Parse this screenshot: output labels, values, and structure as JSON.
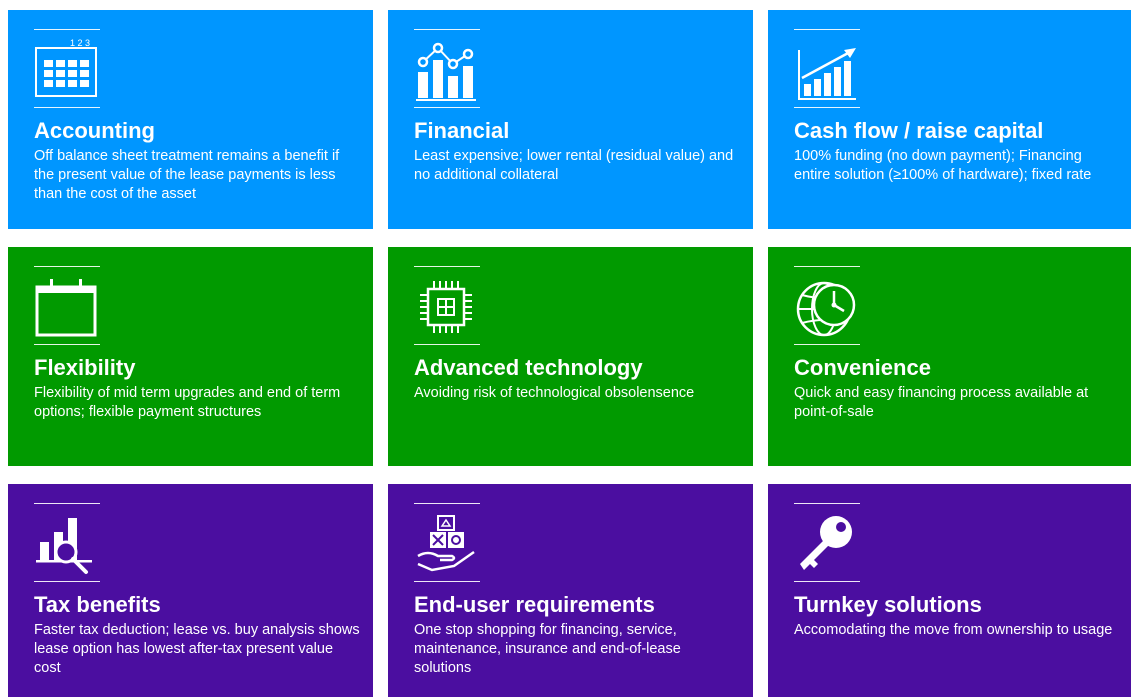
{
  "colors": {
    "blue": "#0096ff",
    "green": "#01a982",
    "green_tile": "#019a00",
    "purple": "#4b0ea0",
    "text": "#ffffff"
  },
  "tiles": [
    {
      "icon": "calendar-grid-icon",
      "icon_text": "1 2 3",
      "title": "Accounting",
      "desc": "Off balance sheet treatment remains a benefit if the present value of the lease payments is less than the cost of the asset"
    },
    {
      "icon": "chart-line-bars-icon",
      "title": "Financial",
      "desc": "Least expensive; lower rental (residual value) and no additional collateral"
    },
    {
      "icon": "growth-bars-icon",
      "title": "Cash flow / raise capital",
      "desc": "100% funding (no down payment); Financing entire solution (≥100% of hardware); fixed rate"
    },
    {
      "icon": "calendar-icon",
      "title": "Flexibility",
      "desc": "Flexibility of mid term upgrades and end of term options; flexible payment structures"
    },
    {
      "icon": "chip-icon",
      "title": "Advanced technology",
      "desc": "Avoiding risk of technological obsolensence"
    },
    {
      "icon": "globe-clock-icon",
      "title": "Convenience",
      "desc": "Quick and easy financing process available at point-of-sale"
    },
    {
      "icon": "magnifier-chart-icon",
      "title": "Tax benefits",
      "desc": "Faster tax deduction; lease vs. buy analysis shows lease option has lowest after-tax present value cost"
    },
    {
      "icon": "hand-boxes-icon",
      "title": "End-user requirements",
      "desc": "One stop shopping for financing, service, maintenance, insurance and end-of-lease solutions"
    },
    {
      "icon": "key-icon",
      "title": "Turnkey solutions",
      "desc": "Accomodating the move from ownership to usage"
    }
  ]
}
